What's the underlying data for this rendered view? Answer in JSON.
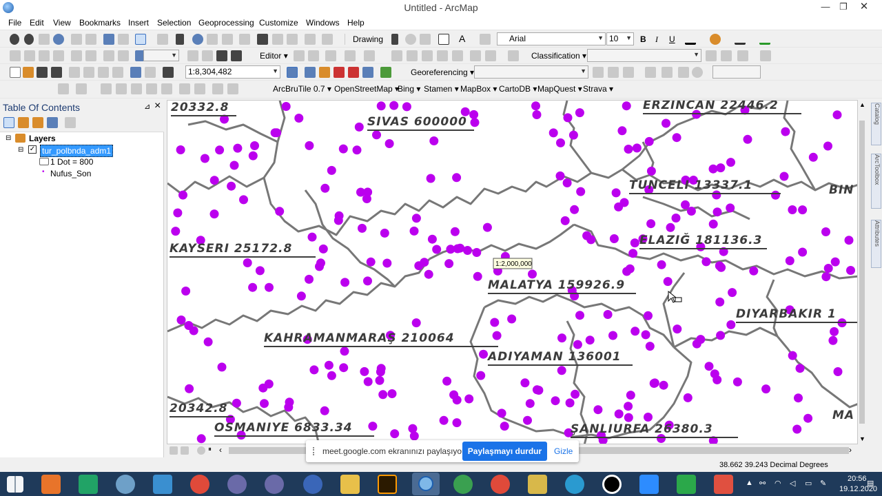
{
  "window": {
    "title": "Untitled - ArcMap"
  },
  "menu": [
    "File",
    "Edit",
    "View",
    "Bookmarks",
    "Insert",
    "Selection",
    "Geoprocessing",
    "Customize",
    "Windows",
    "Help"
  ],
  "toolbar": {
    "drawing_label": "Drawing",
    "font_name": "Arial",
    "font_size": "10",
    "bold": "B",
    "italic": "I",
    "underline": "U",
    "text_tool": "A",
    "editor_label": "Editor",
    "classification_label": "Classification",
    "scale_value": "1:8,304,482",
    "georeferencing_label": "Georeferencing",
    "basemaps": [
      "ArcBruTile 0.7",
      "OpenStreetMap",
      "Bing",
      "Stamen",
      "MapBox",
      "CartoDB",
      "MapQuest",
      "Strava"
    ]
  },
  "toc": {
    "title": "Table Of Contents",
    "pin": "⊿",
    "close": "×",
    "root": "Layers",
    "layer": "tur_polbnda_adm1",
    "legend_dot": "1 Dot = 800",
    "field": "Nufus_Son"
  },
  "map": {
    "scale_tip": "1:2,000,000",
    "labels": [
      "SIVAS 600000",
      "ERZINCAN 22446.2",
      "TUNCELI 13337.1",
      "BIN",
      "KAYSERI 25172.8",
      "ELAZIĞ 181136.3",
      "MALATYA 159926.9",
      "DIYARBAKIR 1",
      "KAHRAMANMARAŞ 210064",
      "ADIYAMAN 136001",
      "20342.8",
      "OSMANIYE 6833.34",
      "ŞANLIURFA 26380.3",
      "MA",
      "20332.8"
    ]
  },
  "dock_tabs": [
    "Catalog",
    "ArcToolbox",
    "Attributes"
  ],
  "status": {
    "coords": "38.662  39.243 Decimal Degrees"
  },
  "share": {
    "message": "meet.google.com ekranınızı paylaşıyor.",
    "stop": "Paylaşmayı durdur",
    "hide": "Gizle"
  },
  "clock": {
    "time": "20:56",
    "date": "19.12.2020"
  },
  "colors": {
    "dots": "#bb00ee",
    "boundaries": "#777777",
    "selection": "#3399ff",
    "titlebar": "#ffffff",
    "taskbar": "#1f3a5a"
  }
}
